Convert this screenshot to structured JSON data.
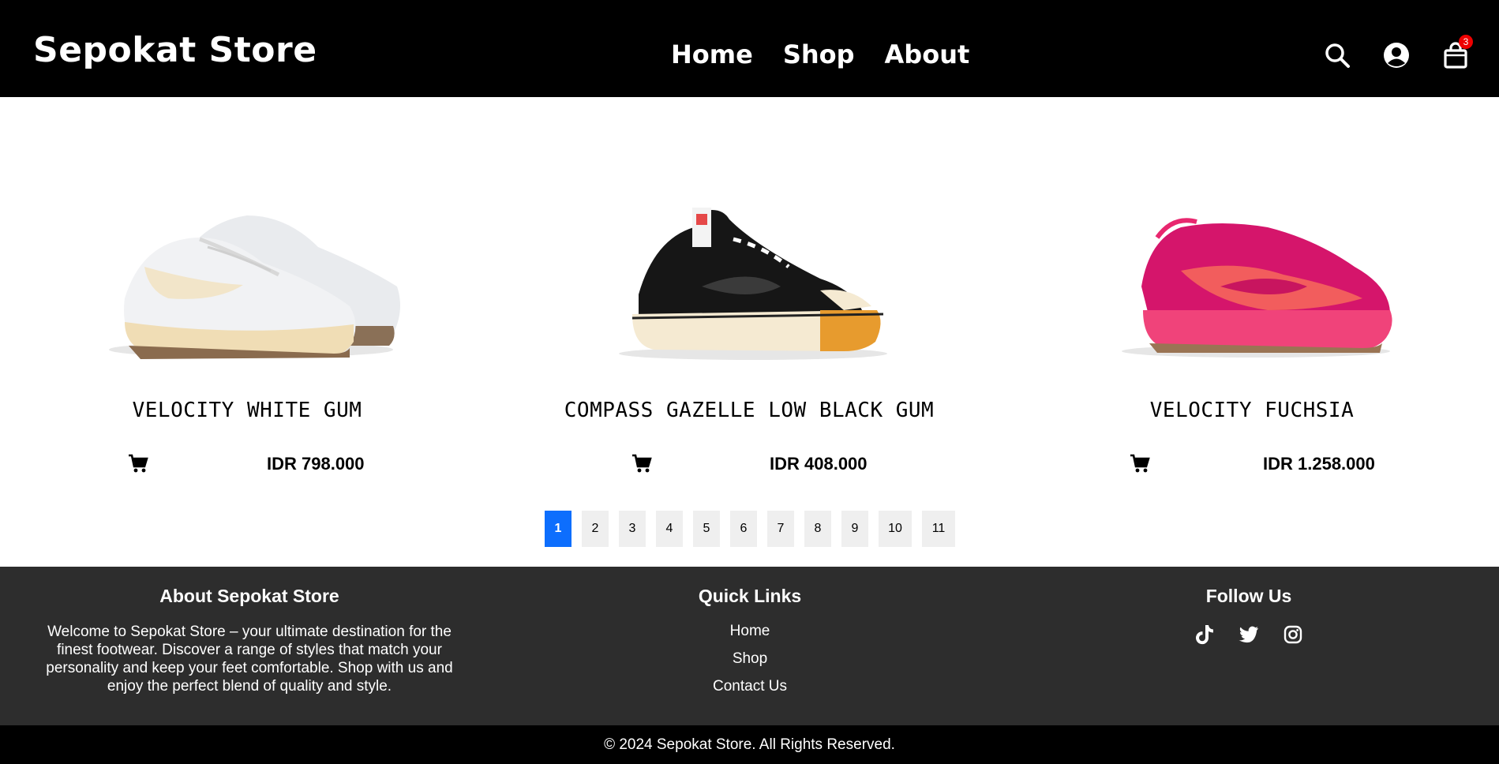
{
  "header": {
    "brand": "Sepokat Store",
    "nav": [
      "Home",
      "Shop",
      "About"
    ],
    "icons": [
      "search-icon",
      "user-icon",
      "bag-icon"
    ],
    "cart_count": "3"
  },
  "products": [
    {
      "name": "VELOCITY WHITE GUM",
      "price": "IDR 798.000",
      "image": "white-cream-sneaker"
    },
    {
      "name": "COMPASS GAZELLE LOW BLACK GUM",
      "price": "IDR 408.000",
      "image": "black-canvas-sneaker"
    },
    {
      "name": "VELOCITY FUCHSIA",
      "price": "IDR 1.258.000",
      "image": "pink-suede-sneaker"
    }
  ],
  "pagination": {
    "pages": [
      "1",
      "2",
      "3",
      "4",
      "5",
      "6",
      "7",
      "8",
      "9",
      "10",
      "11"
    ],
    "current": "1"
  },
  "footer": {
    "about_title": "About Sepokat Store",
    "about_text": "Welcome to Sepokat Store – your ultimate destination for the finest footwear. Discover a range of styles that match your personality and keep your feet comfortable. Shop with us and enjoy the perfect blend of quality and style.",
    "links_title": "Quick Links",
    "links": [
      "Home",
      "Shop",
      "Contact Us"
    ],
    "follow_title": "Follow Us",
    "socials": [
      "tiktok-icon",
      "twitter-icon",
      "instagram-icon"
    ],
    "copyright": "© 2024 Sepokat Store. All Rights Reserved."
  },
  "colors": {
    "header_bg": "#000000",
    "footer_bg": "#2d2d2d",
    "accent": "#0d6efd",
    "badge": "#ee0000"
  }
}
